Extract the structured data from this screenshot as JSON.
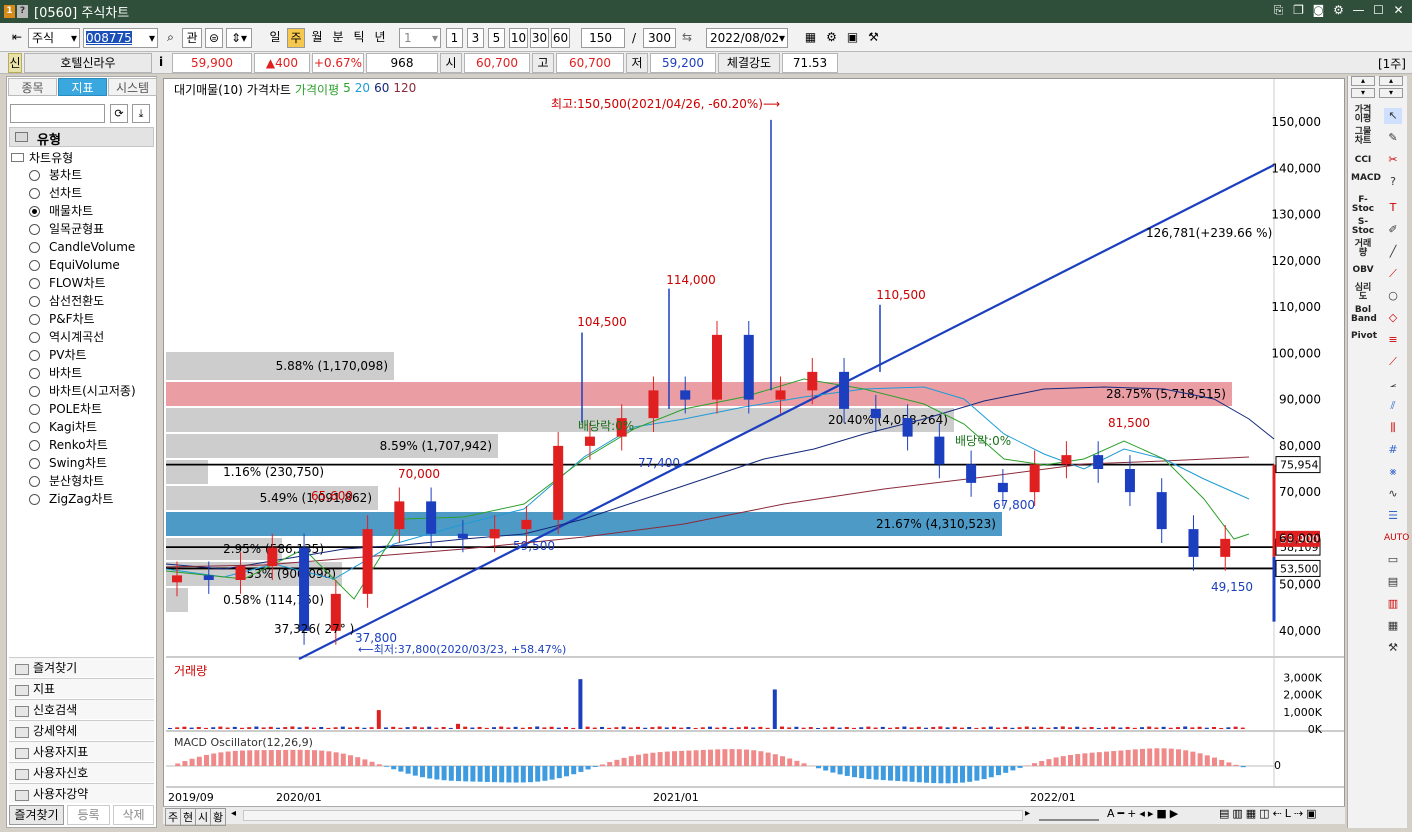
{
  "window": {
    "badge_1": "1",
    "badge_2": "?",
    "title": "[0560] 주식차트"
  },
  "toolbar": {
    "market": "주식",
    "code": "008775",
    "btn_gwan": "관",
    "periods": [
      "일",
      "주",
      "월",
      "분",
      "틱",
      "년"
    ],
    "active_period": "주",
    "interval_value": "1",
    "quick_intervals": [
      "1",
      "3",
      "5",
      "10",
      "30",
      "60"
    ],
    "count": "150",
    "slash": "/",
    "total": "300",
    "date": "2022/08/02"
  },
  "info": {
    "flag": "신",
    "name": "호텔신라우",
    "info_icon": "i",
    "price": "59,900",
    "change": "▲400",
    "change_pct": "+0.67%",
    "volume": "968",
    "open_label": "시",
    "open": "60,700",
    "high_label": "고",
    "high": "60,700",
    "low_label": "저",
    "low": "59,200",
    "strength_label": "체결강도",
    "strength": "71.53",
    "unit": "[1주]"
  },
  "left_panel": {
    "tabs": [
      "종목",
      "지표",
      "시스템"
    ],
    "active_tab": "지표",
    "section_title": "유형",
    "group_title": "차트유형",
    "chart_types": [
      "봉차트",
      "선차트",
      "매물차트",
      "일목균형표",
      "CandleVolume",
      "EquiVolume",
      "FLOW차트",
      "삼선전환도",
      "P&F차트",
      "역시계곡선",
      "PV차트",
      "바차트",
      "바차트(시고저종)",
      "POLE차트",
      "Kagi차트",
      "Renko차트",
      "Swing차트",
      "분산형차트",
      "ZigZag차트"
    ],
    "selected_type": "매물차트",
    "folders": [
      "즐겨찾기",
      "지표",
      "신호검색",
      "강세약세",
      "사용자지표",
      "사용자신호",
      "사용자강약"
    ],
    "bottom_buttons": [
      "즐겨찾기",
      "등록",
      "삭제"
    ]
  },
  "right_panel": {
    "labels": [
      "가격이평",
      "그물차트",
      "CCI",
      "MACD",
      "F-Stoc",
      "S-Stoc",
      "거래량",
      "OBV",
      "심리도",
      "Bol Band",
      "Pivot"
    ]
  },
  "chart": {
    "legend": {
      "prefix": "대기매물(10)",
      "price": "가격차트",
      "ma_label": "가격이평",
      "ma_periods": [
        "5",
        "20",
        "60",
        "120"
      ]
    },
    "y_ticks": [
      "150,000",
      "140,000",
      "130,000",
      "120,000",
      "110,000",
      "100,000",
      "90,000",
      "80,000",
      "70,000",
      "60,000",
      "50,000",
      "40,000"
    ],
    "x_ticks": [
      "2019/09",
      "2020/01",
      "2021/01",
      "2022/01"
    ],
    "annotations": {
      "high_note": "최고:150,500(2021/04/26, -60.20%)⟶",
      "low_note": "⟵최저:37,800(2020/03/23, +58.47%)",
      "trend_note": "126,781(+239.66 %)",
      "low_angle": "37,326( 27° )",
      "div_1": "배당락:0%",
      "div_2": "배당락:0%",
      "peaks": [
        "104,500",
        "114,000",
        "110,500",
        "70,000",
        "65,600",
        "81,500"
      ],
      "troughs": [
        "77,400",
        "59,500",
        "37,800",
        "67,800",
        "49,150"
      ]
    },
    "volume_profile": [
      "5.88% (1,170,098)",
      "28.75% (5,718,515)",
      "20.40% (4,058,264)",
      "8.59% (1,707,942)",
      "1.16% (230,750)",
      "5.49% (1,091,862)",
      "21.67% (4,310,523)",
      "2.95% (586,135)",
      "4.53% (900,098)",
      "0.58% (114,760)"
    ],
    "price_tags": {
      "line_75954": "75,954",
      "line_58109": "58,109",
      "line_53500": "53,500",
      "current": "59,900"
    },
    "volume_panel": {
      "title": "거래량",
      "ticks": [
        "3,000K",
        "2,000K",
        "1,000K",
        "0K"
      ]
    },
    "macd_panel": {
      "title": "MACD Oscillator(12,26,9)",
      "zero": "0"
    },
    "bottom_tabs": [
      "주",
      "현",
      "시",
      "황"
    ]
  },
  "chart_data": {
    "type": "candlestick",
    "title": "",
    "ylim": [
      35000,
      155000
    ],
    "x": [
      "2019/09",
      "2020/01",
      "2021/01",
      "2022/01"
    ],
    "summary": {
      "high": 150500,
      "high_date": "2021/04/26",
      "low": 37800,
      "low_date": "2020/03/23",
      "last": 59900
    },
    "series": [
      {
        "name": "가격차트",
        "approx_closes": [
          52000,
          51000,
          54000,
          58000,
          40000,
          48000,
          62000,
          68000,
          61000,
          60000,
          62000,
          64000,
          80000,
          82000,
          86000,
          92000,
          90000,
          104000,
          90000,
          92000,
          96000,
          88000,
          86000,
          82000,
          76000,
          72000,
          70000,
          76000,
          78000,
          75000,
          70000,
          62000,
          56000,
          59900
        ]
      }
    ]
  }
}
